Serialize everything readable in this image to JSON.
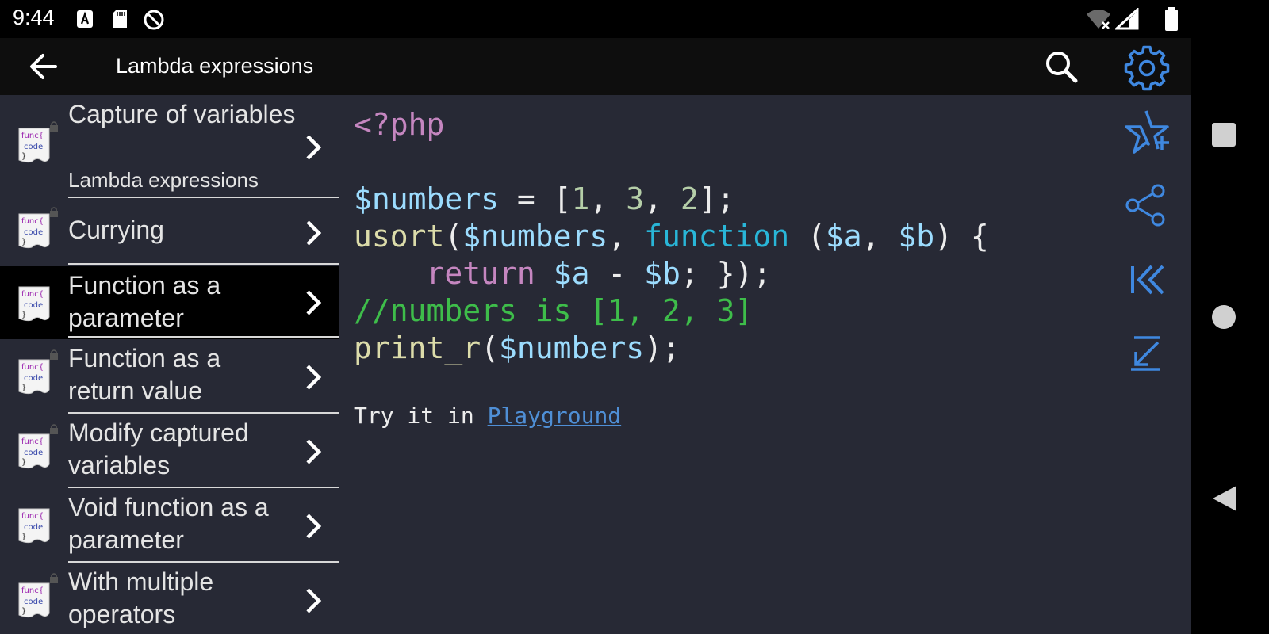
{
  "status_bar": {
    "time": "9:44"
  },
  "app_bar": {
    "title": "Lambda expressions"
  },
  "sidebar": {
    "items": [
      {
        "label": "Capture of variables",
        "sublabel": "Lambda expressions"
      },
      {
        "label": "Currying"
      },
      {
        "label": "Function as a parameter",
        "selected": true
      },
      {
        "label": "Function as a return value"
      },
      {
        "label": "Modify captured variables"
      },
      {
        "label": "Void function as a parameter"
      },
      {
        "label": "With multiple operators"
      }
    ],
    "icon_text": {
      "top": "func{",
      "mid": "code",
      "bottom": "}"
    }
  },
  "code": {
    "open_tag": "<?php",
    "l1_var": "$numbers",
    "l1_eq": " = [",
    "l1_n1": "1",
    "l1_c1": ", ",
    "l1_n2": "3",
    "l1_c2": ", ",
    "l1_n3": "2",
    "l1_end": "];",
    "l2_fn": "usort",
    "l2_p1": "(",
    "l2_var": "$numbers",
    "l2_c": ", ",
    "l2_kw": "function",
    "l2_p2": " (",
    "l2_a": "$a",
    "l2_c2": ", ",
    "l2_b": "$b",
    "l2_end": ") {",
    "l3_indent": "    ",
    "l3_ret": "return",
    "l3_sp": " ",
    "l3_a": "$a",
    "l3_minus": " - ",
    "l3_b": "$b",
    "l3_end": "; });",
    "l4_comment": "//numbers is [1, 2, 3]",
    "l5_fn": "print_r",
    "l5_p": "(",
    "l5_var": "$numbers",
    "l5_end": ");"
  },
  "try_text": "Try it in ",
  "playground_label": "Playground",
  "colors": {
    "background": "#272935",
    "accent": "#4a8fe0",
    "selected": "#000000"
  }
}
